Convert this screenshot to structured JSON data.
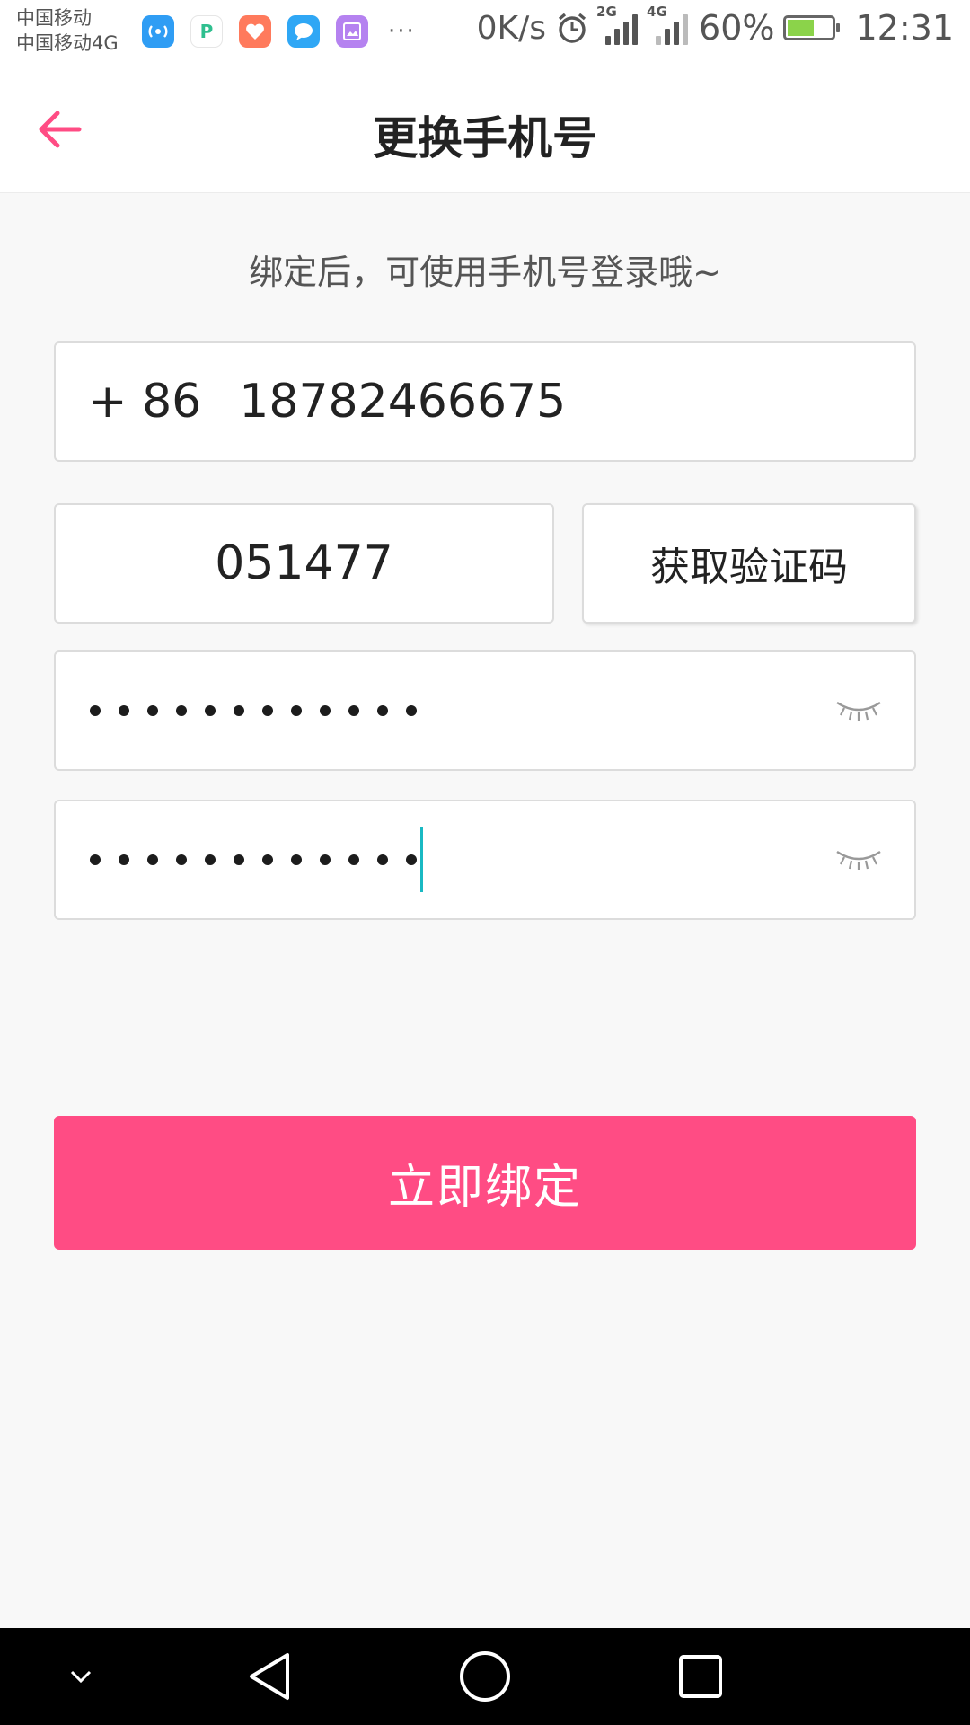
{
  "status_bar": {
    "carrier_1": "中国移动",
    "carrier_2": "中国移动4G",
    "app_icons": [
      "wifi-hotspot-icon",
      "p-app-icon",
      "health-app-icon",
      "message-app-icon",
      "gallery-app-icon"
    ],
    "more": "···",
    "net_speed": "0K/s",
    "signal_1_tag": "2G",
    "signal_2_tag": "4G",
    "battery_percent": "60%",
    "battery_level": 0.6,
    "time": "12:31"
  },
  "header": {
    "title": "更换手机号",
    "back_icon": "arrow-left-icon"
  },
  "form": {
    "hint": "绑定后，可使用手机号登录哦~",
    "country_code": "+ 86",
    "phone_number": "18782466675",
    "verification_code": "051477",
    "get_code_label": "获取验证码",
    "password_length": 12,
    "confirm_password_length": 12
  },
  "submit_label": "立即绑定",
  "colors": {
    "accent": "#ff4c84",
    "caret": "#19b9c3",
    "battery_fill": "#8bd34a"
  },
  "nav_bar": {
    "icons": [
      "collapse-down-icon",
      "back-triangle-icon",
      "home-circle-icon",
      "recents-square-icon"
    ]
  }
}
